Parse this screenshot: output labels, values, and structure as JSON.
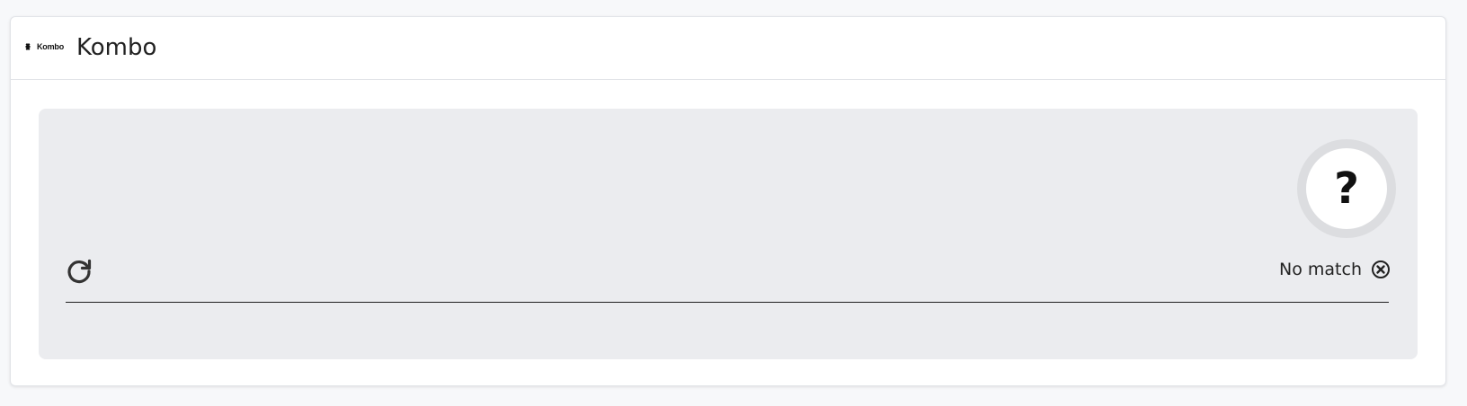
{
  "header": {
    "logo_text": "Kombo",
    "title": "Kombo"
  },
  "panel": {
    "avatar_symbol": "?",
    "status_text": "No match",
    "refresh_icon": "refresh-icon",
    "status_icon": "close-circle-icon"
  },
  "colors": {
    "panel_bg": "#ebecef",
    "card_bg": "#ffffff",
    "divider": "#1f1f1f"
  }
}
